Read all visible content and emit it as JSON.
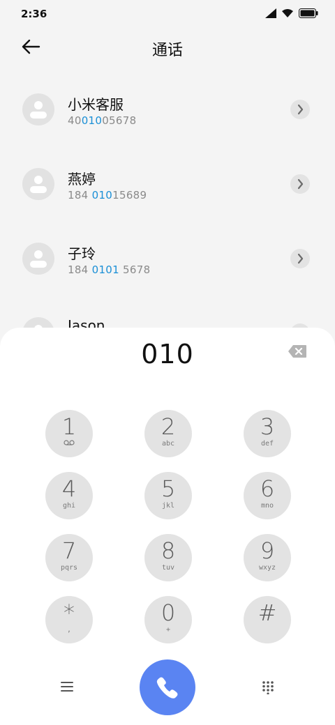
{
  "status_bar": {
    "time": "2:36",
    "icons": [
      "signal-icon",
      "wifi-icon",
      "battery-icon"
    ]
  },
  "header": {
    "title": "通话",
    "back_icon": "back-arrow-icon"
  },
  "contacts": [
    {
      "name": "小米客服",
      "number_parts": [
        "40",
        "010",
        "05678"
      ]
    },
    {
      "name": "燕婷",
      "number_parts": [
        "184 ",
        "010",
        "15689"
      ]
    },
    {
      "name": "子玲",
      "number_parts": [
        "184 ",
        "0101",
        " 5678"
      ]
    },
    {
      "name": "Jason",
      "number_parts": [
        "",
        "",
        ""
      ]
    }
  ],
  "dialer": {
    "entered": "010",
    "keys": [
      {
        "digit": "1",
        "sub": ""
      },
      {
        "digit": "2",
        "sub": "abc"
      },
      {
        "digit": "3",
        "sub": "def"
      },
      {
        "digit": "4",
        "sub": "ghi"
      },
      {
        "digit": "5",
        "sub": "jkl"
      },
      {
        "digit": "6",
        "sub": "mno"
      },
      {
        "digit": "7",
        "sub": "pqrs"
      },
      {
        "digit": "8",
        "sub": "tuv"
      },
      {
        "digit": "9",
        "sub": "wxyz"
      },
      {
        "digit": "*",
        "sub": ","
      },
      {
        "digit": "0",
        "sub": "+"
      },
      {
        "digit": "#",
        "sub": ""
      }
    ]
  },
  "colors": {
    "accent": "#1a8fd6",
    "call_button": "#5a84f2",
    "key_bg": "#e3e3e3"
  }
}
